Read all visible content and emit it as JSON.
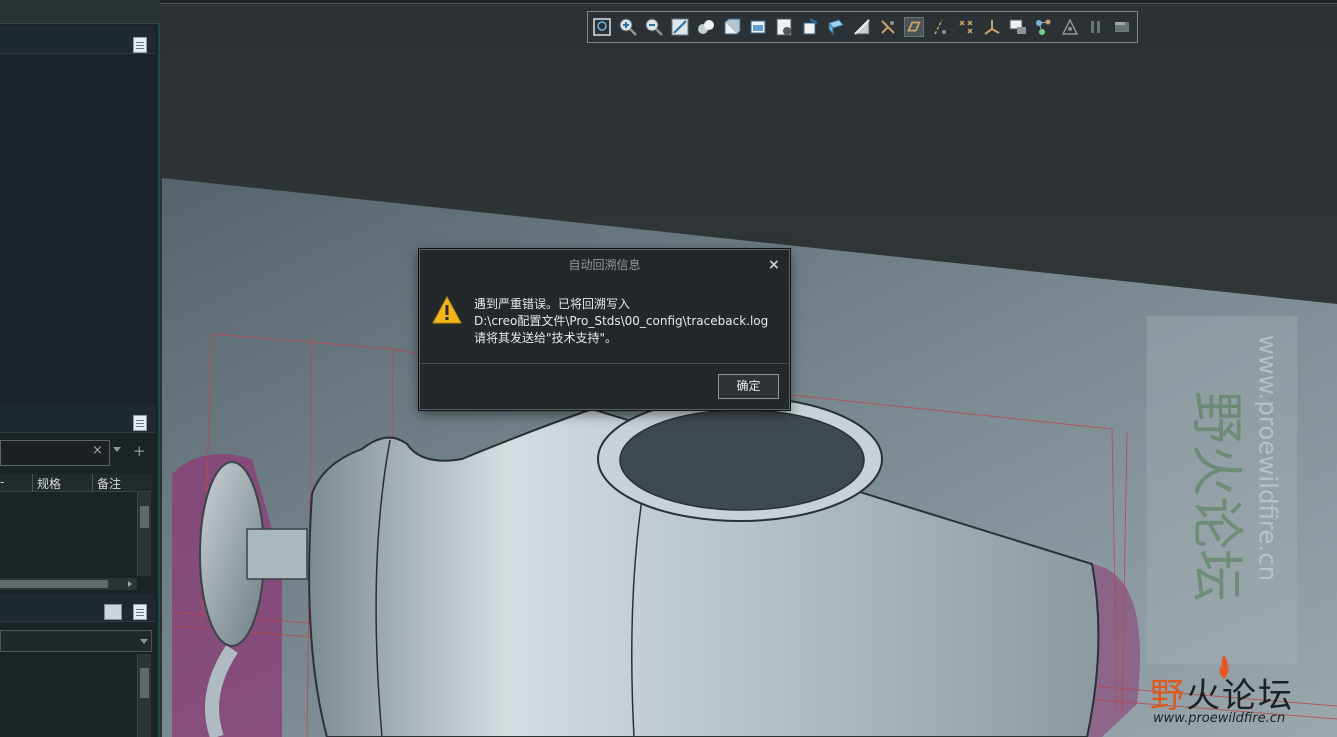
{
  "left_panel": {
    "grid_columns": [
      "-",
      "规格",
      "备注"
    ]
  },
  "toolbar": {
    "icons": [
      "zoom-fit-icon",
      "zoom-in-icon",
      "zoom-out-icon",
      "refit-icon",
      "saved-views-icon",
      "display-style-icon",
      "named-views-icon",
      "view-manager-icon",
      "perspective-icon",
      "section-icon",
      "shading-icon",
      "datum-display-icon",
      "annotation-display-icon",
      "axis-display-icon",
      "point-display-icon",
      "csys-display-icon",
      "spin-center-icon",
      "appearance-icon",
      "pause-icon",
      "graphics-options-icon"
    ]
  },
  "dialog": {
    "title": "自动回溯信息",
    "close": "×",
    "line1": "遇到严重错误。已将回溯写入",
    "line2": "D:\\creo配置文件\\Pro_Stds\\00_config\\traceback.log",
    "line3": "请将其发送给\"技术支持\"。",
    "ok_label": "确定"
  },
  "watermark": {
    "logo_first": "野",
    "logo_rest": "火论坛",
    "url": "www.proewildfire.cn",
    "vertical_cn": "野火论坛",
    "vertical_url": "www.proewildfire.cn"
  },
  "colors": {
    "accent_teal": "#1e4a42",
    "warning_yellow": "#f2b51c",
    "model_magenta": "#8a3f78"
  }
}
